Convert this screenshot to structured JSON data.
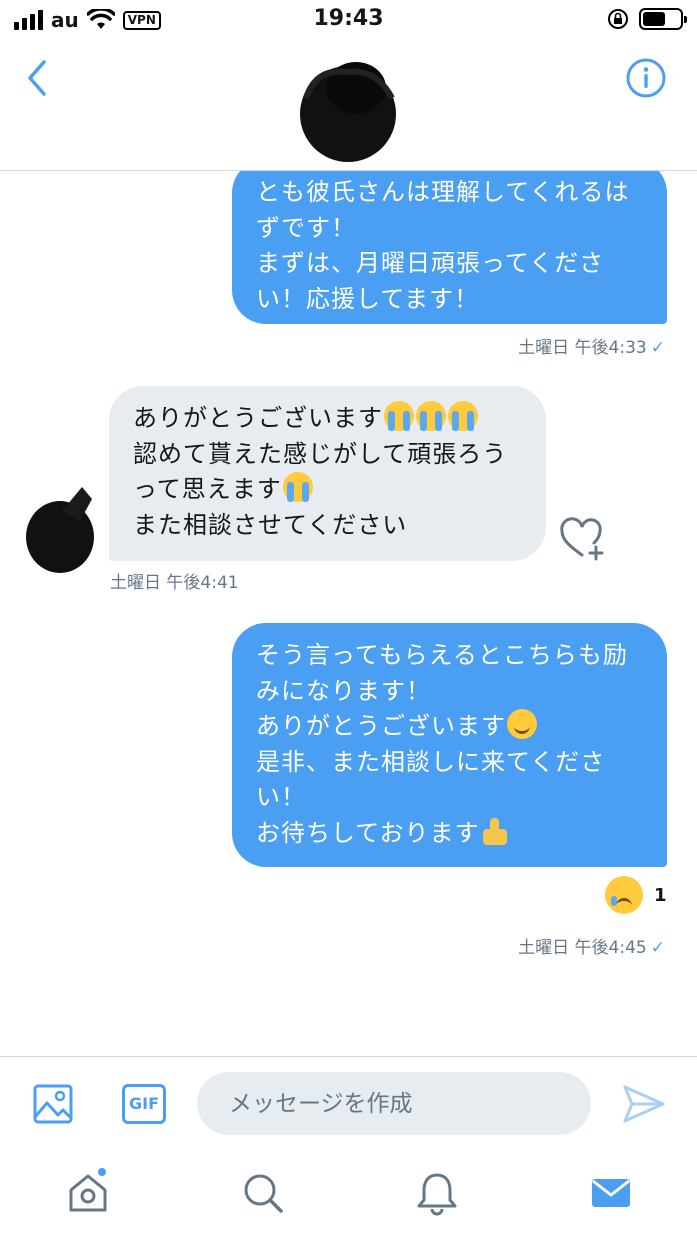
{
  "status_bar": {
    "carrier": "au",
    "vpn": "VPN",
    "time": "19:43"
  },
  "header": {
    "back_icon": "chevron-left-icon",
    "info_icon": "info-icon",
    "accent": "#4a9ff2"
  },
  "messages": [
    {
      "direction": "outgoing",
      "lines": "とも彼氏さんは理解してくれるは\nずです！\nまずは、月曜日頑張ってくださ\nい！応援してます！",
      "timestamp": "土曜日 午後4:33",
      "read": true
    },
    {
      "direction": "incoming",
      "line1": "ありがとうございます",
      "line2": "認めて貰えた感じがして頑張ろう",
      "line3": "って思えます",
      "line4": "また相談させてください",
      "timestamp": "土曜日 午後4:41"
    },
    {
      "direction": "outgoing",
      "line1": "そう言ってもらえるとこちらも励",
      "line2": "みになります！",
      "line3": "ありがとうございます",
      "line4": "是非、また相談しに来てくださ",
      "line5": "い！",
      "line6": "お待ちしております",
      "reaction_icon": "crying-face-emoji",
      "reaction_count": "1",
      "timestamp": "土曜日 午後4:45",
      "read": true
    }
  ],
  "composer": {
    "gif_label": "GIF",
    "placeholder": "メッセージを作成"
  },
  "tabs": [
    {
      "icon": "home-icon",
      "badge": true
    },
    {
      "icon": "search-icon"
    },
    {
      "icon": "bell-icon"
    },
    {
      "icon": "mail-icon",
      "active": true
    }
  ],
  "colors": {
    "outgoing_bubble": "#4a9ff2",
    "incoming_bubble": "#e6ecf0",
    "meta_text": "#657786"
  }
}
